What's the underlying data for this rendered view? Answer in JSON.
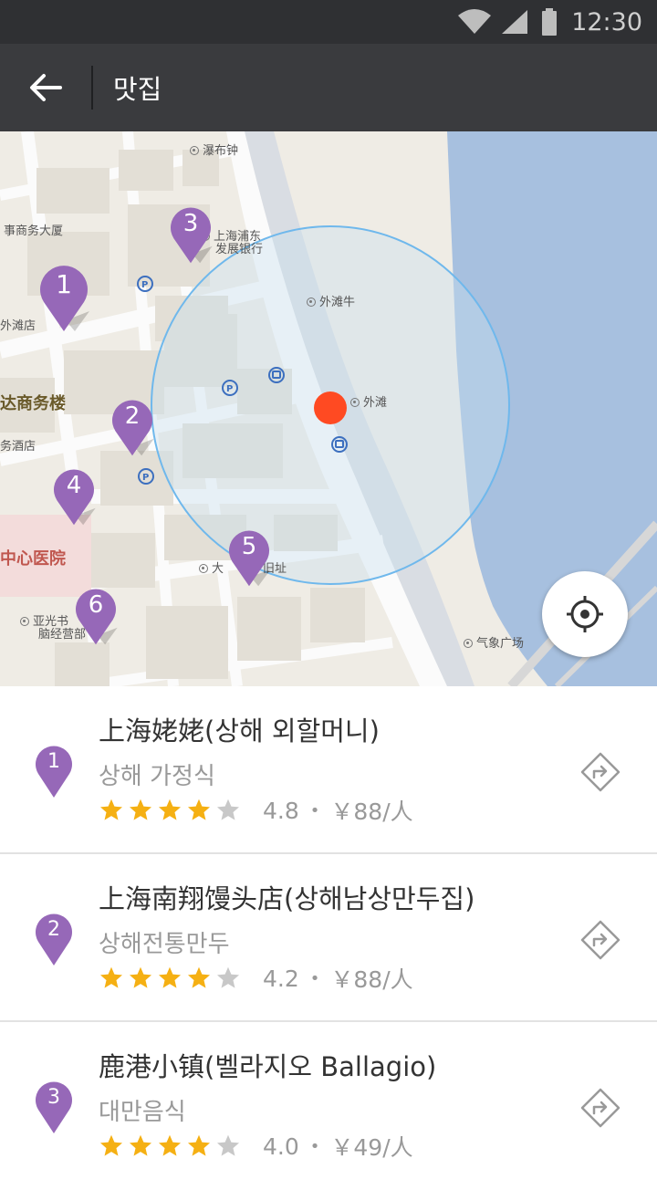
{
  "status_bar": {
    "time": "12:30"
  },
  "app_bar": {
    "title": "맛집"
  },
  "map": {
    "labels": {
      "l1": "瀑布钟",
      "l2": "事商务大厦",
      "l3": "上海浦东",
      "l3b": "发展银行",
      "l4": "外滩店",
      "l5": "外滩牛",
      "l6": "达商务楼",
      "l7": "外滩",
      "l8": "务酒店",
      "l9": "中心医院",
      "l10": "大",
      "l10b": "旧址",
      "l11": "亚光书",
      "l11b": "脑经营部",
      "l12": "气象广场"
    },
    "pins": [
      "1",
      "2",
      "3",
      "4",
      "5",
      "6"
    ],
    "colors": {
      "pin": "#9668b8",
      "water": "#a7c0df",
      "current": "#ff4a22",
      "radius": "#6fb8ec"
    }
  },
  "restaurants": [
    {
      "num": "1",
      "name": "上海姥姥(상해 외할머니)",
      "category": "상해 가정식",
      "rating": 4.8,
      "rating_text": "4.8",
      "dot": "•",
      "price": "￥88/人"
    },
    {
      "num": "2",
      "name": "上海南翔馒头店(상해남상만두집)",
      "category": "상해전통만두",
      "rating": 4.2,
      "rating_text": "4.2",
      "dot": "•",
      "price": "￥88/人"
    },
    {
      "num": "3",
      "name": "鹿港小镇(벨라지오 Ballagio)",
      "category": "대만음식",
      "rating": 4.0,
      "rating_text": "4.0",
      "dot": "•",
      "price": "￥49/人"
    }
  ],
  "colors": {
    "star_on": "#f5b013",
    "star_off": "#c8c8c8"
  }
}
